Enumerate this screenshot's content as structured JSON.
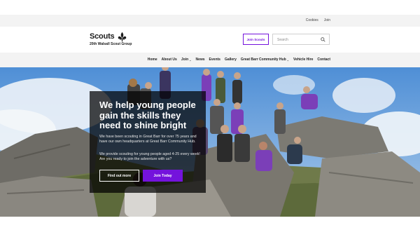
{
  "utility": {
    "links": [
      "Cookies",
      "Join"
    ]
  },
  "brand": {
    "name": "Scouts",
    "group": "20th Walsall Scout Group"
  },
  "header": {
    "join_button": "Join Scouts",
    "search_placeholder": "Search"
  },
  "nav": {
    "items": [
      {
        "label": "Home",
        "dropdown": false
      },
      {
        "label": "About Us",
        "dropdown": false
      },
      {
        "label": "Join",
        "dropdown": true
      },
      {
        "label": "News",
        "dropdown": false
      },
      {
        "label": "Events",
        "dropdown": false
      },
      {
        "label": "Gallery",
        "dropdown": false
      },
      {
        "label": "Great Barr Community Hub",
        "dropdown": true
      },
      {
        "label": "Vehicle Hire",
        "dropdown": false
      },
      {
        "label": "Contact",
        "dropdown": false
      }
    ]
  },
  "hero": {
    "headline": "We help young people gain the skills they need to shine bright",
    "paragraph1": "We have been scouting in Great Barr for over 75 years and have our own headquarters at Great Barr Community Hub.",
    "paragraph2": "We provide scouting for young people aged 4-25 every week! Are you ready to join the adventure with us?",
    "find_out_more": "Find out more",
    "join_today": "Join Today"
  },
  "colors": {
    "accent": "#7413dc",
    "overlay": "#000000"
  }
}
